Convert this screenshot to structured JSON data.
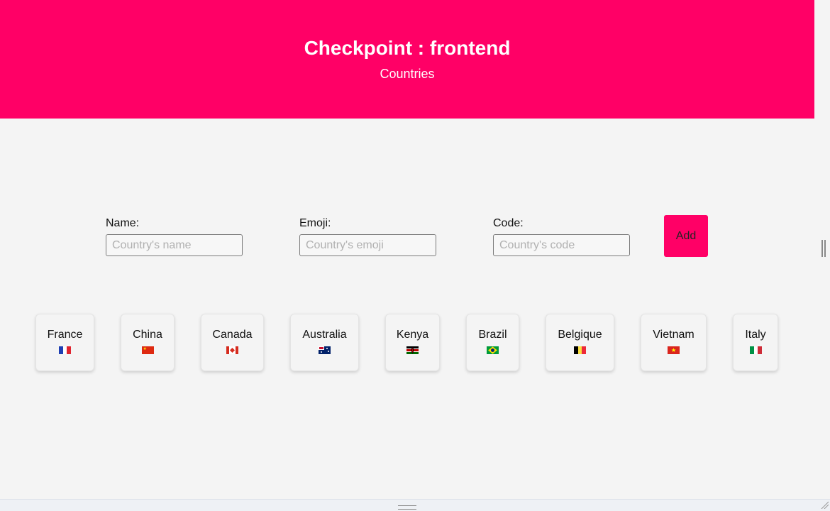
{
  "header": {
    "title": "Checkpoint : frontend",
    "subtitle": "Countries"
  },
  "form": {
    "name": {
      "label": "Name:",
      "placeholder": "Country's name"
    },
    "emoji": {
      "label": "Emoji:",
      "placeholder": "Country's emoji"
    },
    "code": {
      "label": "Code:",
      "placeholder": "Country's code"
    },
    "add_label": "Add"
  },
  "countries": [
    {
      "name": "France",
      "flag": "flag-fr-icon"
    },
    {
      "name": "China",
      "flag": "flag-cn-icon"
    },
    {
      "name": "Canada",
      "flag": "flag-ca-icon"
    },
    {
      "name": "Australia",
      "flag": "flag-au-icon"
    },
    {
      "name": "Kenya",
      "flag": "flag-ke-icon"
    },
    {
      "name": "Brazil",
      "flag": "flag-br-icon"
    },
    {
      "name": "Belgique",
      "flag": "flag-be-icon"
    },
    {
      "name": "Vietnam",
      "flag": "flag-vn-icon"
    },
    {
      "name": "Italy",
      "flag": "flag-it-icon"
    }
  ],
  "colors": {
    "accent": "#ff0066",
    "background": "#f4f4f4"
  }
}
